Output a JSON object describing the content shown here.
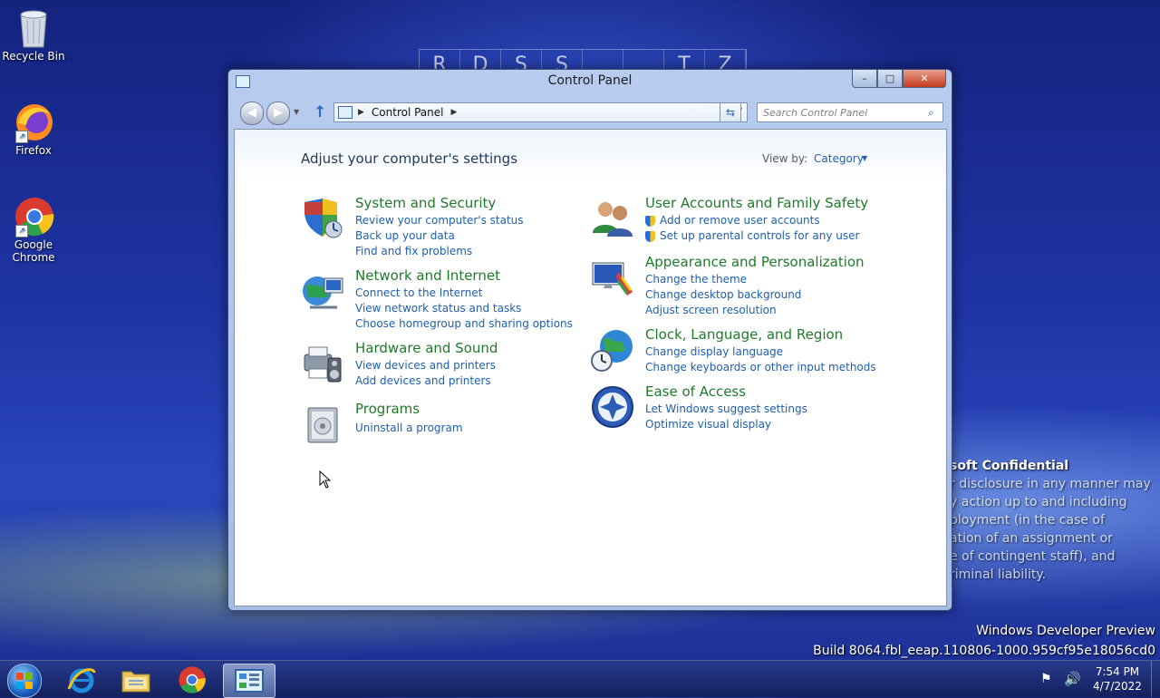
{
  "desktop": {
    "icons": [
      {
        "label": "Recycle Bin"
      },
      {
        "label": "Firefox"
      },
      {
        "label": "Google Chrome"
      }
    ],
    "watermark_letters": [
      "R",
      "D",
      "S",
      "S",
      "",
      "",
      "T",
      "Z"
    ],
    "confidential": {
      "title": "soft Confidential",
      "lines": [
        "r disclosure in any manner may",
        "y action up to and including",
        "ployment (in the case of",
        "ation of an assignment or",
        "e of contingent staff), and",
        "riminal liability."
      ]
    },
    "build": {
      "line1": "Windows Developer Preview",
      "line2": "Build 8064.fbl_eeap.110806-1000.959cf95e18056cd0"
    }
  },
  "window": {
    "title": "Control Panel",
    "controls": {
      "minimize": "–",
      "maximize": "□",
      "close": "✕"
    },
    "address": {
      "path": "Control Panel"
    },
    "search": {
      "placeholder": "Search Control Panel"
    },
    "page_title": "Adjust your computer's settings",
    "view_by": {
      "label": "View by:",
      "value": "Category"
    },
    "categories": [
      {
        "title": "System and Security",
        "icon": "system-security-icon",
        "links": [
          {
            "text": "Review your computer's status"
          },
          {
            "text": "Back up your data"
          },
          {
            "text": "Find and fix problems"
          }
        ]
      },
      {
        "title": "Network and Internet",
        "icon": "network-icon",
        "links": [
          {
            "text": "Connect to the Internet"
          },
          {
            "text": "View network status and tasks"
          },
          {
            "text": "Choose homegroup and sharing options"
          }
        ]
      },
      {
        "title": "Hardware and Sound",
        "icon": "hardware-sound-icon",
        "links": [
          {
            "text": "View devices and printers"
          },
          {
            "text": "Add devices and printers"
          }
        ]
      },
      {
        "title": "Programs",
        "icon": "programs-icon",
        "links": [
          {
            "text": "Uninstall a program"
          }
        ]
      },
      {
        "title": "User Accounts and Family Safety",
        "icon": "user-accounts-icon",
        "links": [
          {
            "text": "Add or remove user accounts",
            "shield": true
          },
          {
            "text": "Set up parental controls for any user",
            "shield": true
          }
        ]
      },
      {
        "title": "Appearance and Personalization",
        "icon": "appearance-icon",
        "links": [
          {
            "text": "Change the theme"
          },
          {
            "text": "Change desktop background"
          },
          {
            "text": "Adjust screen resolution"
          }
        ]
      },
      {
        "title": "Clock, Language, and Region",
        "icon": "clock-language-icon",
        "links": [
          {
            "text": "Change display language"
          },
          {
            "text": "Change keyboards or other input methods"
          }
        ]
      },
      {
        "title": "Ease of Access",
        "icon": "ease-of-access-icon",
        "links": [
          {
            "text": "Let Windows suggest settings"
          },
          {
            "text": "Optimize visual display"
          }
        ]
      }
    ]
  },
  "taskbar": {
    "pinned": [
      {
        "name": "internet-explorer-icon"
      },
      {
        "name": "file-explorer-icon"
      },
      {
        "name": "chrome-icon"
      },
      {
        "name": "control-panel-icon",
        "active": true
      }
    ],
    "clock": {
      "time": "7:54 PM",
      "date": "4/7/2022"
    }
  },
  "colors": {
    "category_title": "#207a2a",
    "link": "#1e5fb0",
    "heading": "#1e395b"
  }
}
